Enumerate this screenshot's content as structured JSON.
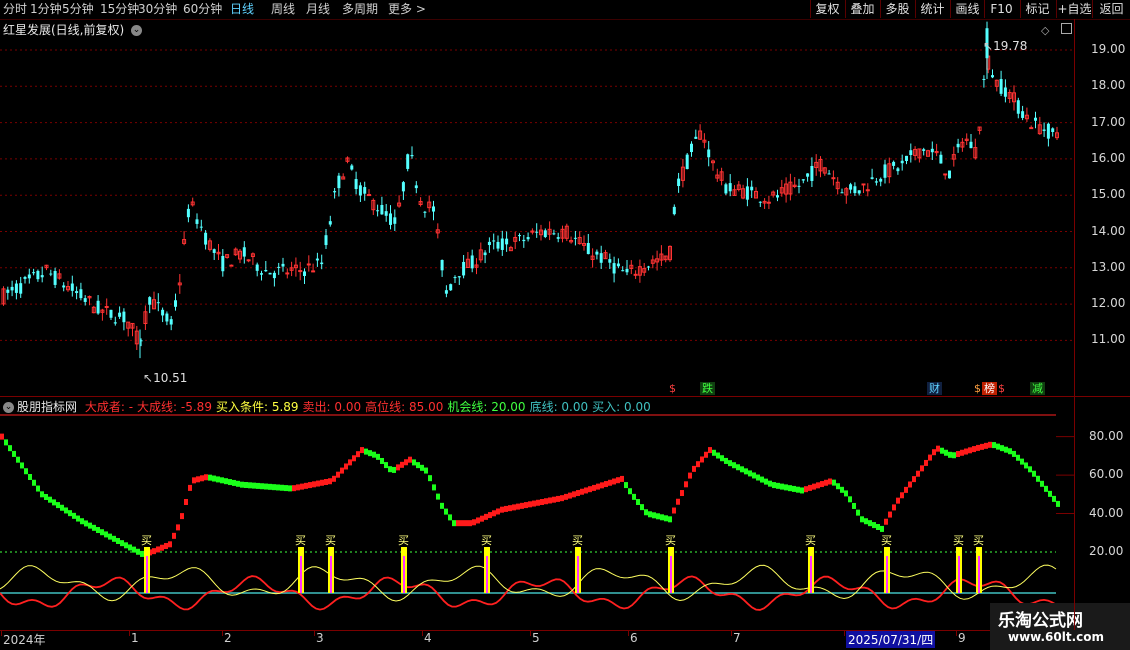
{
  "toolbar": {
    "periods": [
      "分时",
      "1分钟",
      "5分钟",
      "15分钟",
      "30分钟",
      "60分钟",
      "日线",
      "周线",
      "月线",
      "多周期",
      "更多"
    ],
    "active": "日线",
    "more_chevron": ">",
    "right_buttons": [
      "复权",
      "叠加",
      "多股",
      "统计",
      "画线",
      "F10",
      "标记",
      "+自选",
      "返回"
    ]
  },
  "main": {
    "title": "红星发展(日线,前复权)",
    "y_labels": [
      "19.00",
      "18.00",
      "17.00",
      "16.00",
      "15.00",
      "14.00",
      "13.00",
      "12.00",
      "11.00"
    ],
    "high_label": "19.78",
    "low_label": "10.51",
    "signals": [
      "$",
      "跌",
      "财",
      "$",
      "榜",
      "$",
      "减"
    ],
    "colors": {
      "up": "#ff3333",
      "down": "#54ffff",
      "grid": "#7a0000"
    }
  },
  "indicator": {
    "name": "股朋指标网",
    "fields": [
      {
        "text": "大成者: -",
        "color": "#ff3030"
      },
      {
        "text": "大成线: -5.89",
        "color": "#ff3030"
      },
      {
        "text": "买入条件: 5.89",
        "color": "#ffff40"
      },
      {
        "text": "卖出: 0.00",
        "color": "#ff3030"
      },
      {
        "text": "高位线: 85.00",
        "color": "#ff3030"
      },
      {
        "text": "机会线: 20.00",
        "color": "#40ff40"
      },
      {
        "text": "底线: 0.00",
        "color": "#40c0c0"
      },
      {
        "text": "买入: 0.00",
        "color": "#40c0c0"
      }
    ],
    "y_labels": [
      "80.00",
      "60.00",
      "40.00",
      "20.00"
    ],
    "buy_label": "买",
    "buy_count": 12
  },
  "date_axis": {
    "labels": [
      "2024年",
      "1",
      "2",
      "3",
      "4",
      "5",
      "6",
      "7",
      "8",
      "9"
    ],
    "highlight": "2025/07/31/四"
  },
  "watermark": {
    "title": "乐淘公式网",
    "url": "www.60lt.com"
  }
}
